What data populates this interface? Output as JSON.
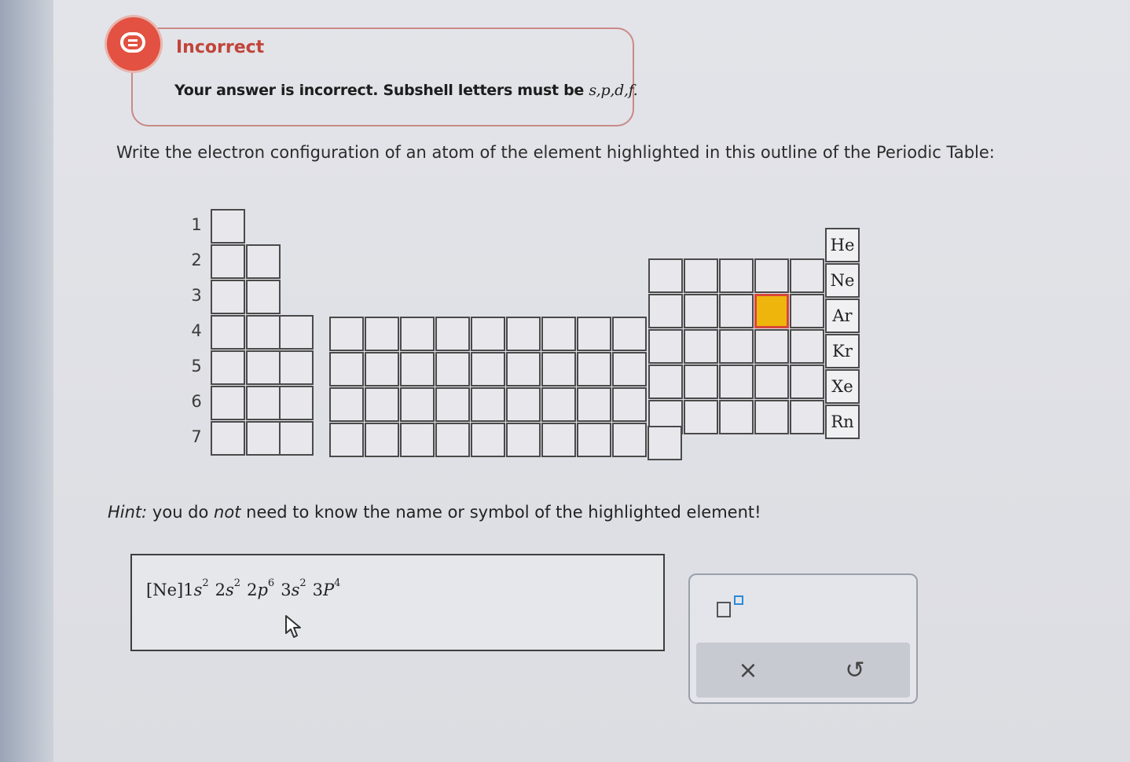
{
  "feedback": {
    "title": "Incorrect",
    "message_prefix": "Your answer is incorrect. Subshell letters must be ",
    "message_letters": "s,p,d,f",
    "message_suffix": "."
  },
  "question": "Write the electron configuration of an atom of the element highlighted in this outline of the Periodic Table:",
  "periodic_table": {
    "row_numbers": [
      "1",
      "2",
      "3",
      "4",
      "5",
      "6",
      "7"
    ],
    "noble_gases": [
      "He",
      "Ne",
      "Ar",
      "Kr",
      "Xe",
      "Rn"
    ],
    "highlighted": {
      "period": 3,
      "group": 16
    }
  },
  "hint": {
    "label": "Hint:",
    "part1": " you do ",
    "emph": "not",
    "part2": " need to know the name or symbol of the highlighted element!"
  },
  "answer": {
    "prefix": "[Ne]",
    "terms": [
      {
        "coef": "1",
        "letter": "s",
        "exp": "2"
      },
      {
        "coef": "2",
        "letter": "s",
        "exp": "2"
      },
      {
        "coef": "2",
        "letter": "p",
        "exp": "6"
      },
      {
        "coef": "3",
        "letter": "s",
        "exp": "2"
      },
      {
        "coef": "3",
        "letter": "P",
        "exp": "4"
      }
    ]
  },
  "tools": {
    "clear_symbol": "×",
    "undo_symbol": "↺"
  },
  "icons": {
    "feedback": "chat-bubble-icon",
    "superscript": "superscript-box-icon",
    "cursor": "mouse-pointer-icon"
  },
  "colors": {
    "error": "#e25141",
    "highlight": "#eeb60c"
  }
}
